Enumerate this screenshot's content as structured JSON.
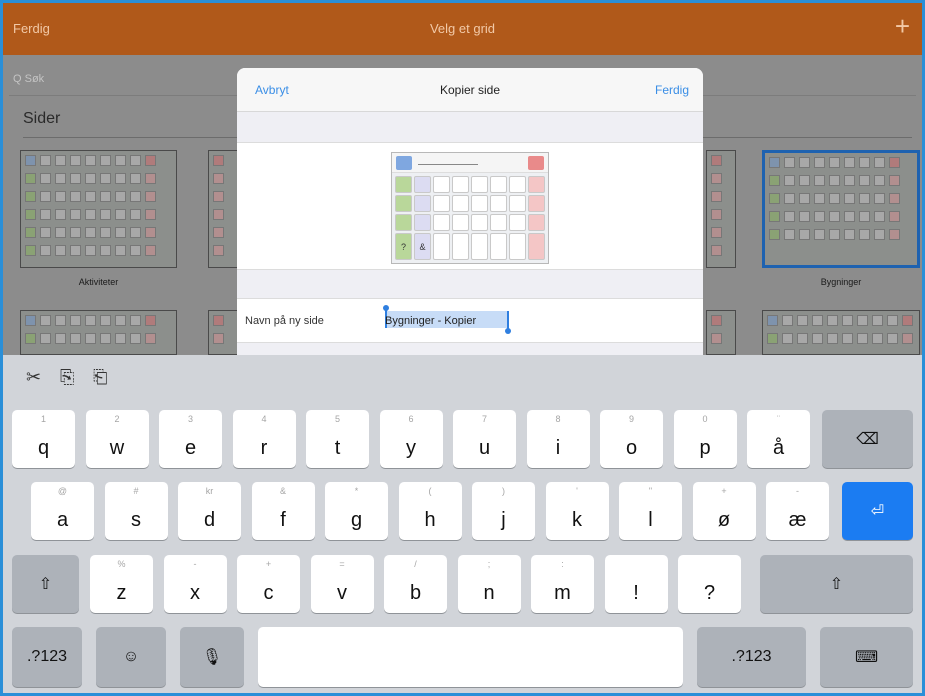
{
  "topbar": {
    "left": "Ferdig",
    "title": "Velg et grid",
    "add_icon": "+"
  },
  "background": {
    "search_placeholder": "Q Søk",
    "section_title": "Sider",
    "thumbs": [
      {
        "label": "Aktiviteter"
      },
      {
        "label": ""
      },
      {
        "label": ""
      },
      {
        "label": "Bygninger"
      }
    ]
  },
  "modal": {
    "cancel": "Avbryt",
    "title": "Kopier side",
    "done": "Ferdig",
    "name_label": "Navn på ny side",
    "name_value": "Bygninger - Kopier",
    "preview_cells": [
      "",
      "",
      "",
      "",
      "",
      "",
      "",
      "",
      "",
      "",
      "",
      "",
      "",
      "",
      "",
      "",
      "",
      "",
      "",
      "",
      "",
      "",
      "",
      "",
      "?",
      "&",
      "",
      "",
      "",
      "",
      "",
      ""
    ]
  },
  "keyboard": {
    "tools": {
      "cut": "✂",
      "copy": "⎘",
      "paste": "⎗"
    },
    "row1": [
      {
        "main": "q",
        "hint": "1"
      },
      {
        "main": "w",
        "hint": "2"
      },
      {
        "main": "e",
        "hint": "3"
      },
      {
        "main": "r",
        "hint": "4"
      },
      {
        "main": "t",
        "hint": "5"
      },
      {
        "main": "y",
        "hint": "6"
      },
      {
        "main": "u",
        "hint": "7"
      },
      {
        "main": "i",
        "hint": "8"
      },
      {
        "main": "o",
        "hint": "9"
      },
      {
        "main": "p",
        "hint": "0"
      },
      {
        "main": "å",
        "hint": "¨"
      }
    ],
    "row2": [
      {
        "main": "a",
        "hint": "@"
      },
      {
        "main": "s",
        "hint": "#"
      },
      {
        "main": "d",
        "hint": "kr"
      },
      {
        "main": "f",
        "hint": "&"
      },
      {
        "main": "g",
        "hint": "*"
      },
      {
        "main": "h",
        "hint": "("
      },
      {
        "main": "j",
        "hint": ")"
      },
      {
        "main": "k",
        "hint": "'"
      },
      {
        "main": "l",
        "hint": "\""
      },
      {
        "main": "ø",
        "hint": "+"
      },
      {
        "main": "æ",
        "hint": "-"
      }
    ],
    "row3": [
      {
        "main": "z",
        "hint": "%"
      },
      {
        "main": "x",
        "hint": "-"
      },
      {
        "main": "c",
        "hint": "+"
      },
      {
        "main": "v",
        "hint": "="
      },
      {
        "main": "b",
        "hint": "/"
      },
      {
        "main": "n",
        "hint": ";"
      },
      {
        "main": "m",
        "hint": ":"
      },
      {
        "main": "!",
        "hint": ""
      },
      {
        "main": "?",
        "hint": ""
      }
    ],
    "backspace": "⌫",
    "return": "⏎",
    "shift": "⇧",
    "numbers_left": ".?123",
    "numbers_right": ".?123",
    "emoji": "☺",
    "mic": "🎙",
    "hide": "⌨"
  }
}
